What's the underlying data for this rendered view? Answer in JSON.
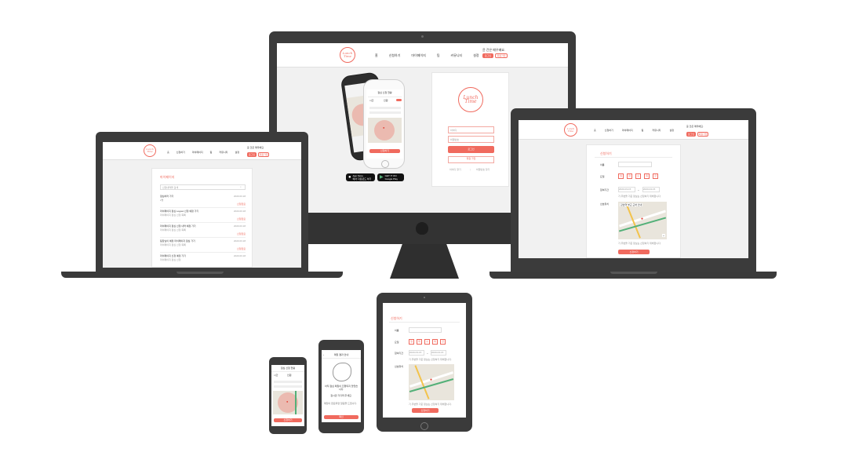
{
  "brand": {
    "logo_text": "Lunch Time",
    "accent": "#f06a5e",
    "frame": "#3b3b3b"
  },
  "nav": {
    "items": [
      "홈",
      "신청하기",
      "마이페이지",
      "팀",
      "커뮤니티",
      "설정"
    ]
  },
  "header_user": {
    "greeting": "윤 건은 매우배요.",
    "login": "로그인",
    "signup": "회원가입",
    "greeting_short": "로그인"
  },
  "login_card": {
    "id_placeholder": "아이디",
    "pw_placeholder": "비밀번호",
    "login_button": "로그인",
    "signup_button": "회원 가입",
    "find_id": "아이디 찾기",
    "find_pw": "비밀번호 찾기",
    "divider": "|"
  },
  "stores": {
    "appstore_small": "Download on the",
    "appstore": "App Store",
    "appstore_kr": "에서 다운로드 하기",
    "googleplay_small": "GET IT ON",
    "googleplay": "Google Play"
  },
  "request_form": {
    "title": "신청하기",
    "label_name": "이름",
    "label_days": "요일",
    "label_period": "참여기간",
    "label_location": "선호위치",
    "days": [
      "월",
      "화",
      "수",
      "목",
      "금"
    ],
    "date_from": "2020-03-15",
    "date_sep": "~",
    "date_to": "2020-04-15",
    "checkbox": "기 주변을 기준 정보는 신청하기 위해합니다.",
    "submit": "신청하기",
    "map_search": "강남역 부근 근처 안내"
  },
  "my_page": {
    "title": "마이페이지",
    "search_placeholder": "신청내역을 검색",
    "items": [
      {
        "title": "점심하러 가기",
        "sub": "2명",
        "date": "2020.03.18"
      },
      {
        "title": "마이페이지 점심 Logout 신청 예정 가기",
        "sub": "마이페이지 점심 신청 목록",
        "date": "2020.03.18"
      },
      {
        "title": "마이페이지 점심 신청 내역 예정 가기",
        "sub": "마이페이지 점심 신청 목록",
        "date": "2020.03.18"
      },
      {
        "title": "팀장님이 예정 마이페이지 점심 가기",
        "sub": "마이페이지 점심 신청 목록",
        "date": "2020.03.18"
      },
      {
        "title": "마이페이지 신청 예정 가기",
        "sub": "마이페이지 점심 신청",
        "date": "2020.03.18"
      }
    ],
    "status_label": "신청완료"
  },
  "mobile_match": {
    "title": "매칭 결과 안내",
    "line1": "아직 점심 매칭이 진행되지 않았습니다.",
    "line2": "잠시만 기다려 주세요.",
    "note": "매칭이 완료되면 알림을 드립니다.",
    "button": "확인"
  },
  "phone_screen": {
    "title": "점심 신청 현황",
    "col1": "시간",
    "col2": "인원",
    "btn": "신청하기"
  }
}
